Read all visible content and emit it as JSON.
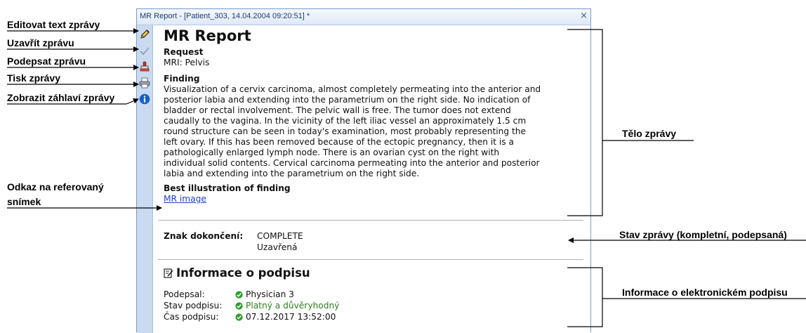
{
  "callouts": {
    "edit_text": "Editovat text zprávy",
    "close_report": "Uzavřít zprávu",
    "sign_report": "Podepsat zprávu",
    "print_report": "Tisk zprávy",
    "show_header": "Zobrazit záhlaví zprávy",
    "reference_link_line1": "Odkaz na referovaný",
    "reference_link_line2": "snímek",
    "report_body": "Tělo zprávy",
    "report_status": "Stav zprávy (kompletní, podepsaná)",
    "signature_info": "Informace o elektronickém podpisu"
  },
  "window": {
    "title": "MR Report - [Patient_303, 14.04.2004 09:20:51] *",
    "close_glyph": "×"
  },
  "toolbar": {
    "icons": [
      "pencil-icon",
      "checkmark-icon",
      "stamp-icon",
      "printer-icon",
      "info-icon"
    ]
  },
  "report": {
    "title": "MR Report",
    "request_heading": "Request",
    "request_text": "MRI: Pelvis",
    "finding_heading": "Finding",
    "finding_lines": [
      "Visualization of a cervix carcinoma, almost completely permeating into the anterior and",
      "posterior labia and extending into the parametrium on the right side. No indication of",
      "bladder or rectal involvement. The pelvic wall is free. The tumor does not extend",
      "caudally to the vagina. In the vicinity of the left iliac vessel an approximately 1.5 cm",
      "round structure can be seen in today's examination, most probably representing the",
      "left ovary. If this has been removed because of the ectopic pregnancy, then it is a",
      "pathologically enlarged lymph node. There is an ovarian cyst on the right with",
      "individual solid contents. Cervical carcinoma permeating into the anterior and posterior",
      "labia and extending into the parametrium on the right side."
    ],
    "illustration_heading": "Best illustration of finding",
    "image_link": "MR image"
  },
  "status": {
    "label": "Znak dokončení:",
    "value_line1": "COMPLETE",
    "value_line2": "Uzavřená"
  },
  "signature": {
    "heading": "Informace o podpisu",
    "signed_by_label": "Podepsal:",
    "signed_by_value": "Physician 3",
    "state_label": "Stav podpisu:",
    "state_value": "Platný a důvěryhodný",
    "time_label": "Čas podpisu:",
    "time_value": "07.12.2017 13:52:00"
  },
  "colors": {
    "accent_blue": "#1a3fcc",
    "toolbar_bg": "#c9daf1",
    "valid_green": "#2e7d1f"
  }
}
